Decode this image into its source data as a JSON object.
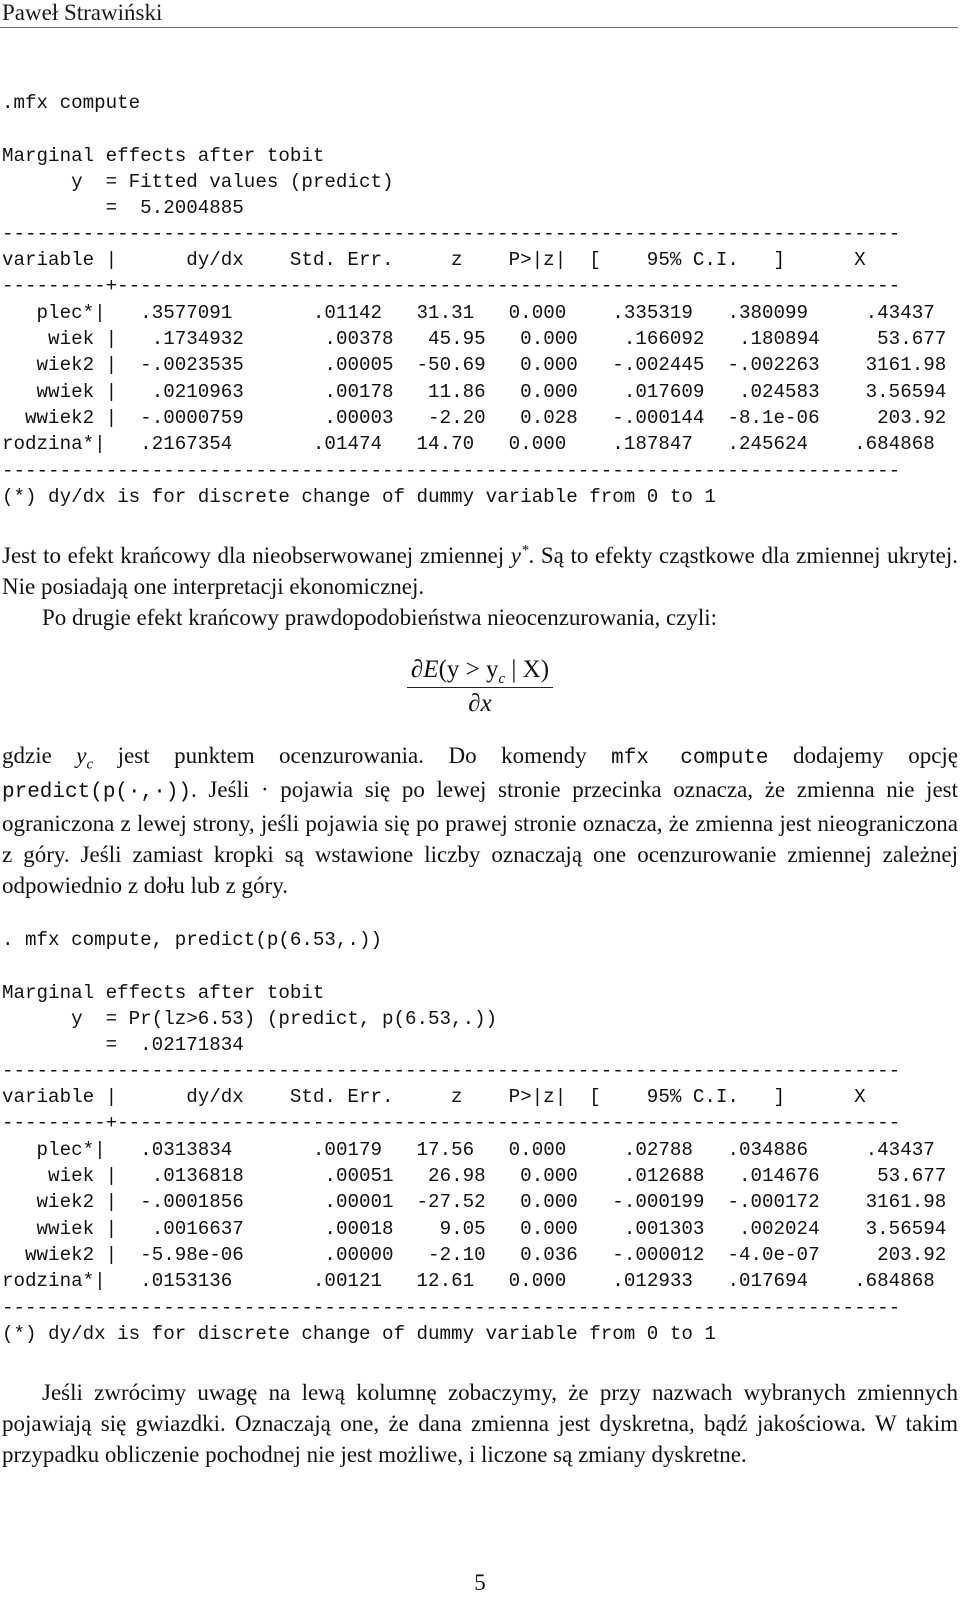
{
  "running_head": "Paweł Strawiński",
  "page_number": "5",
  "block1": {
    "command": ".mfx compute",
    "title": "Marginal effects after tobit",
    "y_line": "      y  = Fitted values (predict)",
    "eq_line": "         =  5.2004885",
    "rule": "------------------------------------------------------------------------------",
    "header": "variable |      dy/dx    Std. Err.     z    P>|z|  [    95% C.I.   ]      X",
    "sep": "---------+--------------------------------------------------------------------",
    "columns": [
      "variable",
      "dy/dx",
      "Std. Err.",
      "z",
      "P>|z|",
      "95% C.I. low",
      "95% C.I. high",
      "X"
    ],
    "rows": [
      {
        "variable": "plec*",
        "bar": "|",
        "dydx": ".3577091",
        "se": ".01142",
        "z": "31.31",
        "p": "0.000",
        "ci_lo": ".335319",
        "ci_hi": ".380099",
        "x": ".43437"
      },
      {
        "variable": "wiek",
        "bar": " |",
        "dydx": ".1734932",
        "se": ".00378",
        "z": "45.95",
        "p": "0.000",
        "ci_lo": ".166092",
        "ci_hi": ".180894",
        "x": "53.677"
      },
      {
        "variable": "wiek2",
        "bar": " |",
        "dydx": "-.0023535",
        "se": ".00005",
        "z": "-50.69",
        "p": "0.000",
        "ci_lo": "-.002445",
        "ci_hi": "-.002263",
        "x": "3161.98"
      },
      {
        "variable": "wwiek",
        "bar": " |",
        "dydx": ".0210963",
        "se": ".00178",
        "z": "11.86",
        "p": "0.000",
        "ci_lo": ".017609",
        "ci_hi": ".024583",
        "x": "3.56594"
      },
      {
        "variable": "wwiek2",
        "bar": " |",
        "dydx": "-.0000759",
        "se": ".00003",
        "z": "-2.20",
        "p": "0.028",
        "ci_lo": "-.000144",
        "ci_hi": "-8.1e-06",
        "x": "203.92"
      },
      {
        "variable": "rodzina*",
        "bar": "|",
        "dydx": ".2167354",
        "se": ".01474",
        "z": "14.70",
        "p": "0.000",
        "ci_lo": ".187847",
        "ci_hi": ".245624",
        "x": ".684868"
      }
    ],
    "footnote": "(*) dy/dx is for discrete change of dummy variable from 0 to 1"
  },
  "para1": {
    "text_a": "Jest to efekt krańcowy dla nieobserwowanej zmiennej ",
    "math_y": "y",
    "math_star": "*",
    "text_b": ". Są to efekty cząstkowe dla zmiennej ukrytej. Nie posiadają one interpretacji ekonomicznej."
  },
  "para2": {
    "text": "Po drugie efekt krańcowy prawdopodobieństwa nieocenzurowania, czyli:"
  },
  "formula": {
    "partial": "∂",
    "numerator_a": "E",
    "numerator_b": "(y > y",
    "numerator_sub": "c",
    "numerator_c": " | X)",
    "denominator": "∂x"
  },
  "para3": {
    "t1": "gdzie ",
    "y": "y",
    "y_sub": "c",
    "t2": " jest punktem ocenzurowania. Do komendy ",
    "code1": "mfx compute",
    "t3": " dodajemy opcję ",
    "code2": "predict(p(·,·))",
    "t4": ". Jeśli · pojawia się po lewej stronie przecinka oznacza, że zmienna nie jest ograniczona z lewej strony, jeśli pojawia się po prawej stronie oznacza, że zmienna jest nieograniczona z góry. Jeśli zamiast kropki są wstawione liczby oznaczają one ocenzurowanie zmiennej zależnej odpowiednio z dołu lub z góry."
  },
  "block2": {
    "command": ". mfx compute, predict(p(6.53,.))",
    "title": "Marginal effects after tobit",
    "y_line": "      y  = Pr(lz>6.53) (predict, p(6.53,.))",
    "eq_line": "         =  .02171834",
    "rule": "------------------------------------------------------------------------------",
    "header": "variable |      dy/dx    Std. Err.     z    P>|z|  [    95% C.I.   ]      X",
    "sep": "---------+--------------------------------------------------------------------",
    "rows": [
      {
        "variable": "plec*",
        "bar": "|",
        "dydx": ".0313834",
        "se": ".00179",
        "z": "17.56",
        "p": "0.000",
        "ci_lo": ".02788",
        "ci_hi": ".034886",
        "x": ".43437"
      },
      {
        "variable": "wiek",
        "bar": " |",
        "dydx": ".0136818",
        "se": ".00051",
        "z": "26.98",
        "p": "0.000",
        "ci_lo": ".012688",
        "ci_hi": ".014676",
        "x": "53.677"
      },
      {
        "variable": "wiek2",
        "bar": " |",
        "dydx": "-.0001856",
        "se": ".00001",
        "z": "-27.52",
        "p": "0.000",
        "ci_lo": "-.000199",
        "ci_hi": "-.000172",
        "x": "3161.98"
      },
      {
        "variable": "wwiek",
        "bar": " |",
        "dydx": ".0016637",
        "se": ".00018",
        "z": "9.05",
        "p": "0.000",
        "ci_lo": ".001303",
        "ci_hi": ".002024",
        "x": "3.56594"
      },
      {
        "variable": "wwiek2",
        "bar": " |",
        "dydx": "-5.98e-06",
        "se": ".00000",
        "z": "-2.10",
        "p": "0.036",
        "ci_lo": "-.000012",
        "ci_hi": "-4.0e-07",
        "x": "203.92"
      },
      {
        "variable": "rodzina*",
        "bar": "|",
        "dydx": ".0153136",
        "se": ".00121",
        "z": "12.61",
        "p": "0.000",
        "ci_lo": ".012933",
        "ci_hi": ".017694",
        "x": ".684868"
      }
    ],
    "footnote": "(*) dy/dx is for discrete change of dummy variable from 0 to 1"
  },
  "para4": {
    "text": "Jeśli zwrócimy uwagę na lewą kolumnę zobaczymy, że przy nazwach wybranych zmiennych pojawiają się gwiazdki. Oznaczają one, że dana zmienna jest dyskretna, bądź jakościowa. W takim przypadku obliczenie pochodnej nie jest możliwe, i liczone są zmiany dyskretne."
  }
}
